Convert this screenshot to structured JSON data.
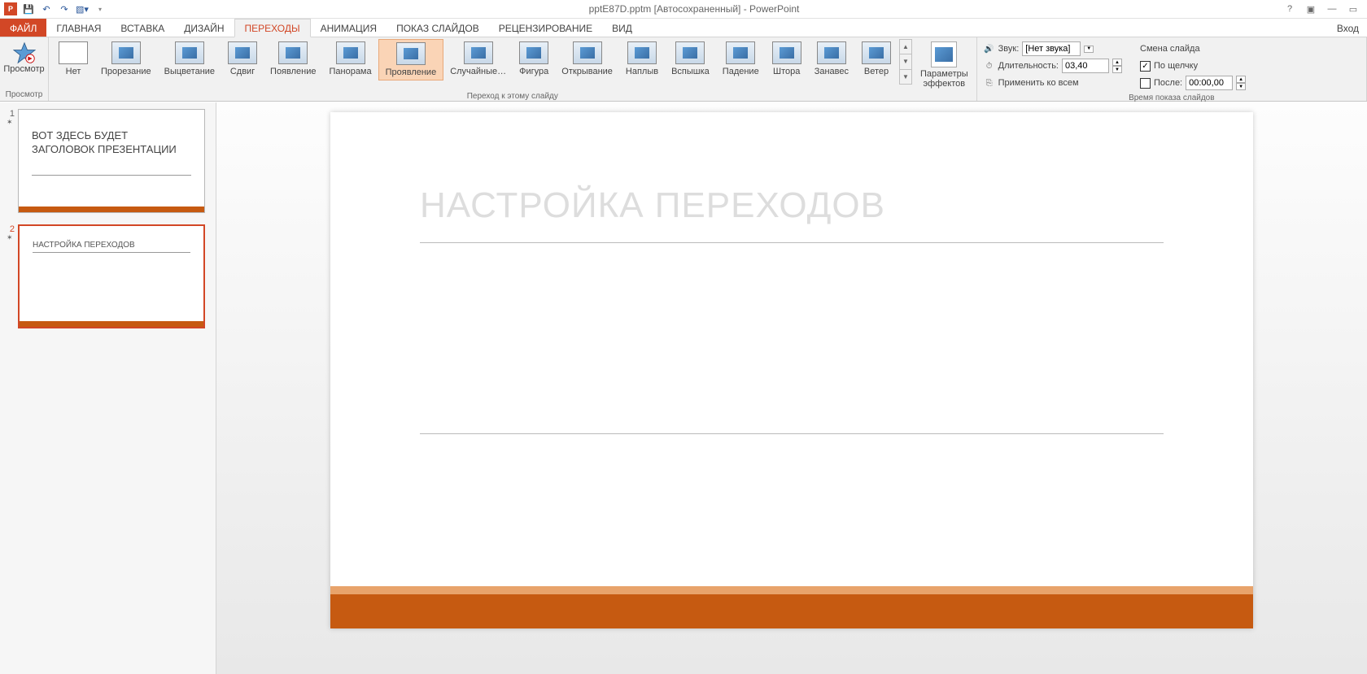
{
  "title": "pptE87D.pptm [Автосохраненный] - PowerPoint",
  "login_label": "Вход",
  "tabs": {
    "file": "ФАЙЛ",
    "home": "ГЛАВНАЯ",
    "insert": "ВСТАВКА",
    "design": "ДИЗАЙН",
    "transitions": "ПЕРЕХОДЫ",
    "animations": "АНИМАЦИЯ",
    "slideshow": "ПОКАЗ СЛАЙДОВ",
    "review": "РЕЦЕНЗИРОВАНИЕ",
    "view": "ВИД"
  },
  "preview": {
    "btn": "Просмотр",
    "group": "Просмотр"
  },
  "transitions": {
    "items": [
      "Нет",
      "Прорезание",
      "Выцветание",
      "Сдвиг",
      "Появление",
      "Панорама",
      "Проявление",
      "Случайные…",
      "Фигура",
      "Открывание",
      "Наплыв",
      "Вспышка",
      "Падение",
      "Штора",
      "Занавес",
      "Ветер"
    ],
    "selected_index": 6,
    "options_btn": "Параметры\nэффектов",
    "group": "Переход к этому слайду"
  },
  "timing": {
    "sound_label": "Звук:",
    "sound_value": "[Нет звука]",
    "duration_label": "Длительность:",
    "duration_value": "03,40",
    "apply_all": "Применить ко всем",
    "advance_header": "Смена слайда",
    "on_click": "По щелчку",
    "on_click_checked": true,
    "after_label": "После:",
    "after_checked": false,
    "after_value": "00:00,00",
    "group": "Время показа слайдов"
  },
  "thumbnails": {
    "slide1_num": "1",
    "slide1_title": "ВОТ ЗДЕСЬ БУДЕТ ЗАГОЛОВОК ПРЕЗЕНТАЦИИ",
    "slide2_num": "2",
    "slide2_title": "НАСТРОЙКА ПЕРЕХОДОВ"
  },
  "slide": {
    "title": "НАСТРОЙКА ПЕРЕХОДОВ"
  }
}
